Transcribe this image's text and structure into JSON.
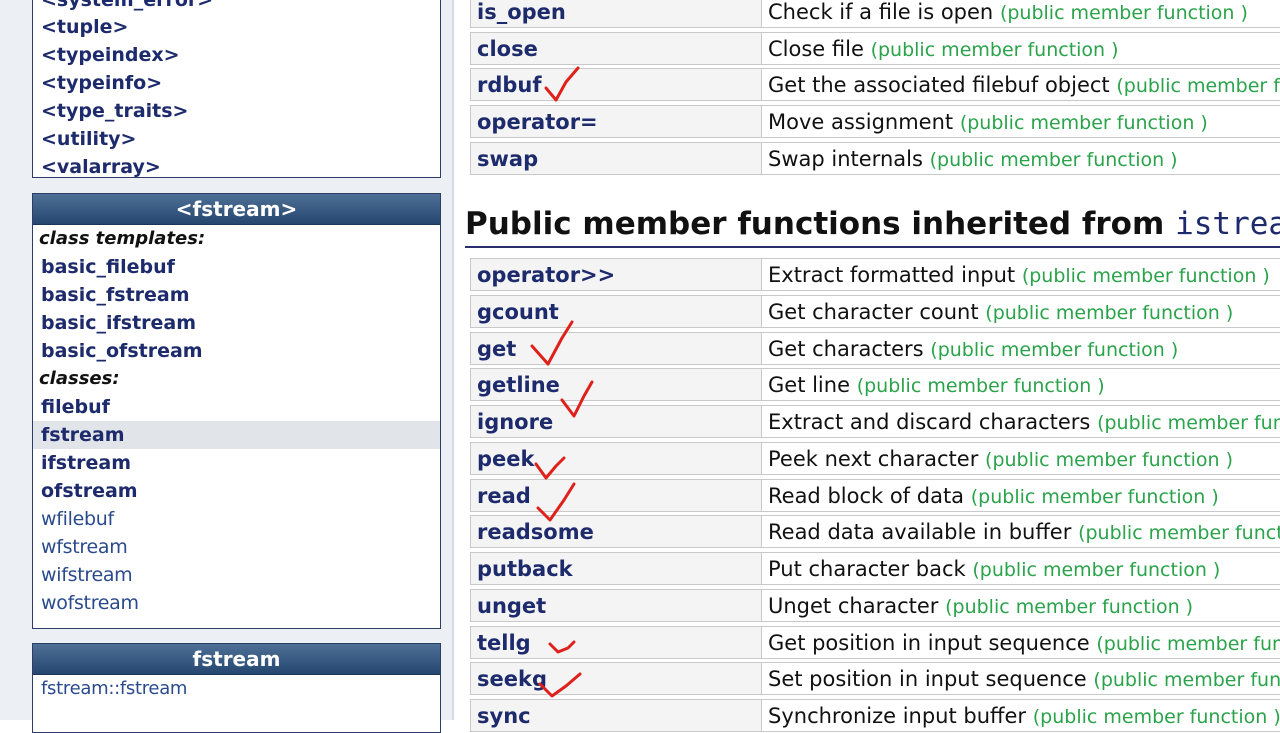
{
  "sidebar": {
    "headers_list": [
      {
        "label": "<system_error>"
      },
      {
        "label": "<tuple>"
      },
      {
        "label": "<typeindex>"
      },
      {
        "label": "<typeinfo>"
      },
      {
        "label": "<type_traits>"
      },
      {
        "label": "<utility>"
      },
      {
        "label": "<valarray>"
      }
    ],
    "fstream_box": {
      "title": "<fstream>",
      "class_templates_label": "class templates:",
      "class_templates": [
        "basic_filebuf",
        "basic_fstream",
        "basic_ifstream",
        "basic_ofstream"
      ],
      "classes_label": "classes:",
      "classes": [
        "filebuf",
        "fstream",
        "ifstream",
        "ofstream"
      ],
      "wide_classes": [
        "wfilebuf",
        "wfstream",
        "wifstream",
        "wofstream"
      ]
    },
    "class_box": {
      "title": "fstream",
      "items": [
        "fstream::fstream"
      ]
    }
  },
  "tag_text": "(public member function )",
  "top_rows": [
    {
      "name": "is_open",
      "desc": "Check if a file is open"
    },
    {
      "name": "close",
      "desc": "Close file"
    },
    {
      "name": "rdbuf",
      "desc": "Get the associated filebuf object"
    },
    {
      "name": "operator=",
      "desc": "Move assignment"
    },
    {
      "name": "swap",
      "desc": "Swap internals"
    }
  ],
  "section": {
    "title": "Public member functions inherited from ",
    "code": "istream"
  },
  "inherited_rows": [
    {
      "name": "operator>>",
      "desc": "Extract formatted input"
    },
    {
      "name": "gcount",
      "desc": "Get character count"
    },
    {
      "name": "get",
      "desc": "Get characters"
    },
    {
      "name": "getline",
      "desc": "Get line"
    },
    {
      "name": "ignore",
      "desc": "Extract and discard characters"
    },
    {
      "name": "peek",
      "desc": "Peek next character"
    },
    {
      "name": "read",
      "desc": "Read block of data"
    },
    {
      "name": "readsome",
      "desc": "Read data available in buffer"
    },
    {
      "name": "putback",
      "desc": "Put character back"
    },
    {
      "name": "unget",
      "desc": "Unget character"
    },
    {
      "name": "tellg",
      "desc": "Get position in input sequence"
    },
    {
      "name": "seekg",
      "desc": "Set position in input sequence"
    },
    {
      "name": "sync",
      "desc": "Synchronize input buffer"
    }
  ],
  "colors": {
    "accent": "#25476f",
    "link": "#1d2a6b",
    "tag": "#2aa34a",
    "annotation": "#e0201b"
  }
}
